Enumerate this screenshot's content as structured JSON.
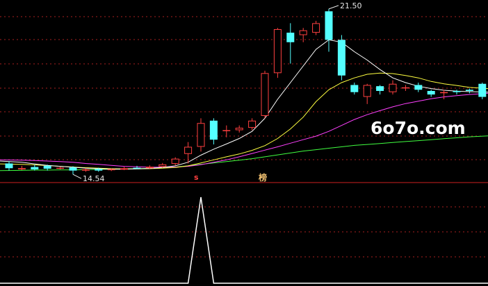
{
  "chart_data": {
    "type": "candlestick",
    "annotations": {
      "high_label": "21.50",
      "low_label": "14.54",
      "signal_marker_1": "s",
      "signal_marker_2": "榜"
    },
    "watermark": "6o7o.com",
    "colors": {
      "up": "#ff4040",
      "down": "#54ffff",
      "ma1": "#ffffff",
      "ma2": "#ffff40",
      "ma3": "#ff40ff",
      "ma4": "#40ff40",
      "grid": "#aa2020",
      "indicator": "#ffffff"
    },
    "candles": [
      {
        "o": 15.0,
        "c": 14.8,
        "h": 15.1,
        "l": 14.7
      },
      {
        "o": 14.75,
        "c": 14.8,
        "h": 14.9,
        "l": 14.72
      },
      {
        "o": 14.85,
        "c": 14.75,
        "h": 14.95,
        "l": 14.7
      },
      {
        "o": 14.9,
        "c": 14.78,
        "h": 14.95,
        "l": 14.7
      },
      {
        "o": 14.8,
        "c": 14.82,
        "h": 14.87,
        "l": 14.75
      },
      {
        "o": 14.83,
        "c": 14.7,
        "h": 14.88,
        "l": 14.54
      },
      {
        "o": 14.7,
        "c": 14.75,
        "h": 14.8,
        "l": 14.65
      },
      {
        "o": 14.77,
        "c": 14.7,
        "h": 14.82,
        "l": 14.65
      },
      {
        "o": 14.72,
        "c": 14.76,
        "h": 14.8,
        "l": 14.68
      },
      {
        "o": 14.74,
        "c": 14.8,
        "h": 14.86,
        "l": 14.72
      },
      {
        "o": 14.82,
        "c": 14.78,
        "h": 14.9,
        "l": 14.76
      },
      {
        "o": 14.8,
        "c": 14.86,
        "h": 14.92,
        "l": 14.78
      },
      {
        "o": 14.86,
        "c": 14.96,
        "h": 15.02,
        "l": 14.82
      },
      {
        "o": 14.98,
        "c": 15.2,
        "h": 15.26,
        "l": 14.92
      },
      {
        "o": 15.4,
        "c": 15.7,
        "h": 15.9,
        "l": 15.0
      },
      {
        "o": 15.7,
        "c": 16.7,
        "h": 16.9,
        "l": 15.5
      },
      {
        "o": 16.8,
        "c": 16.0,
        "h": 16.9,
        "l": 15.8
      },
      {
        "o": 16.4,
        "c": 16.4,
        "h": 16.6,
        "l": 16.1
      },
      {
        "o": 16.4,
        "c": 16.5,
        "h": 16.6,
        "l": 16.3
      },
      {
        "o": 16.5,
        "c": 16.8,
        "h": 16.9,
        "l": 16.4
      },
      {
        "o": 17.0,
        "c": 18.8,
        "h": 18.9,
        "l": 16.9
      },
      {
        "o": 18.8,
        "c": 20.65,
        "h": 20.7,
        "l": 18.6
      },
      {
        "o": 20.5,
        "c": 20.1,
        "h": 20.9,
        "l": 19.2
      },
      {
        "o": 20.4,
        "c": 20.6,
        "h": 20.7,
        "l": 20.1
      },
      {
        "o": 20.5,
        "c": 20.9,
        "h": 21.0,
        "l": 20.4
      },
      {
        "o": 21.4,
        "c": 20.2,
        "h": 21.5,
        "l": 19.7
      },
      {
        "o": 20.2,
        "c": 18.7,
        "h": 20.4,
        "l": 18.5
      },
      {
        "o": 18.3,
        "c": 18.0,
        "h": 18.4,
        "l": 17.9
      },
      {
        "o": 17.8,
        "c": 18.3,
        "h": 18.35,
        "l": 17.5
      },
      {
        "o": 18.25,
        "c": 18.05,
        "h": 18.3,
        "l": 17.9
      },
      {
        "o": 18.0,
        "c": 18.35,
        "h": 18.5,
        "l": 17.9
      },
      {
        "o": 18.2,
        "c": 18.2,
        "h": 18.3,
        "l": 18.05
      },
      {
        "o": 18.3,
        "c": 18.1,
        "h": 18.4,
        "l": 18.0
      },
      {
        "o": 18.05,
        "c": 17.9,
        "h": 18.1,
        "l": 17.8
      },
      {
        "o": 18.0,
        "c": 18.0,
        "h": 18.1,
        "l": 17.7
      },
      {
        "o": 18.05,
        "c": 18.0,
        "h": 18.1,
        "l": 17.9
      },
      {
        "o": 18.1,
        "c": 18.05,
        "h": 18.15,
        "l": 17.95
      },
      {
        "o": 18.35,
        "c": 17.8,
        "h": 18.4,
        "l": 17.7
      }
    ],
    "ma1": [
      15.1,
      15.05,
      14.98,
      14.92,
      14.88,
      14.84,
      14.8,
      14.78,
      14.76,
      14.76,
      14.77,
      14.79,
      14.83,
      14.9,
      15.05,
      15.35,
      15.6,
      15.82,
      16.05,
      16.35,
      16.9,
      17.7,
      18.4,
      19.1,
      19.8,
      20.2,
      20.1,
      19.7,
      19.35,
      18.95,
      18.6,
      18.4,
      18.25,
      18.15,
      18.08,
      18.04,
      18.02,
      18.0
    ],
    "ma2": [
      14.98,
      14.96,
      14.94,
      14.91,
      14.88,
      14.85,
      14.82,
      14.8,
      14.78,
      14.77,
      14.77,
      14.78,
      14.8,
      14.83,
      14.9,
      15.02,
      15.15,
      15.28,
      15.4,
      15.55,
      15.75,
      16.05,
      16.45,
      16.95,
      17.6,
      18.1,
      18.4,
      18.6,
      18.75,
      18.8,
      18.78,
      18.7,
      18.6,
      18.45,
      18.35,
      18.28,
      18.2,
      18.15
    ],
    "ma3": [
      15.15,
      15.14,
      15.12,
      15.1,
      15.08,
      15.05,
      15.0,
      14.96,
      14.92,
      14.88,
      14.86,
      14.84,
      14.84,
      14.85,
      14.88,
      14.95,
      15.05,
      15.15,
      15.28,
      15.42,
      15.56,
      15.7,
      15.85,
      16.0,
      16.15,
      16.35,
      16.6,
      16.85,
      17.05,
      17.22,
      17.38,
      17.52,
      17.62,
      17.72,
      17.8,
      17.85,
      17.9,
      17.95
    ],
    "ma4": [
      14.7,
      14.71,
      14.72,
      14.72,
      14.73,
      14.73,
      14.74,
      14.75,
      14.76,
      14.77,
      14.78,
      14.8,
      14.82,
      14.85,
      14.9,
      14.96,
      15.02,
      15.08,
      15.14,
      15.2,
      15.28,
      15.36,
      15.44,
      15.52,
      15.58,
      15.64,
      15.7,
      15.76,
      15.8,
      15.84,
      15.88,
      15.92,
      15.96,
      16.0,
      16.04,
      16.08,
      16.12,
      16.16
    ],
    "indicator": {
      "peak_index": 15,
      "values": [
        0,
        0,
        0,
        0,
        0,
        0,
        0,
        0,
        0,
        0,
        0,
        0,
        0,
        0,
        0,
        1,
        0,
        0,
        0,
        0,
        0,
        0,
        0,
        0,
        0,
        0,
        0,
        0,
        0,
        0,
        0,
        0,
        0,
        0,
        0,
        0,
        0,
        0
      ]
    },
    "y_range_price": [
      14.4,
      21.7
    ]
  }
}
